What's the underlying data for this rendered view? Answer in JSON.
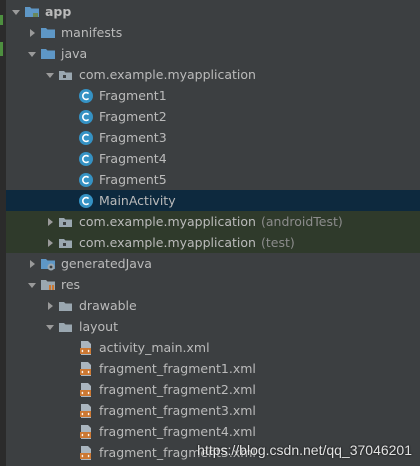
{
  "colors": {
    "background": "#3c3f41",
    "selected_row": "#0d293e",
    "green_row": "#2f3a2b",
    "text": "#bbbbbb",
    "dim_text": "#8c8c8c",
    "folder_blue": "#5e97c6",
    "package_gray": "#9aa7b0",
    "class_circle": "#3592c4",
    "xml_orange": "#cc7832"
  },
  "tree": {
    "app": "app",
    "manifests": "manifests",
    "java": "java",
    "pkg_main": "com.example.myapplication",
    "classes": [
      "Fragment1",
      "Fragment2",
      "Fragment3",
      "Fragment4",
      "Fragment5",
      "MainActivity"
    ],
    "class_icon_letter": "C",
    "pkg_android_test": "com.example.myapplication",
    "pkg_android_test_suffix": "(androidTest)",
    "pkg_test": "com.example.myapplication",
    "pkg_test_suffix": "(test)",
    "generated_java": "generatedJava",
    "res": "res",
    "drawable": "drawable",
    "layout": "layout",
    "layout_files": [
      "activity_main.xml",
      "fragment_fragment1.xml",
      "fragment_fragment2.xml",
      "fragment_fragment3.xml",
      "fragment_fragment4.xml",
      "fragment_fragment5.xml"
    ],
    "selected_item": "MainActivity"
  },
  "watermark": "https://blog.csdn.net/qq_37046201"
}
